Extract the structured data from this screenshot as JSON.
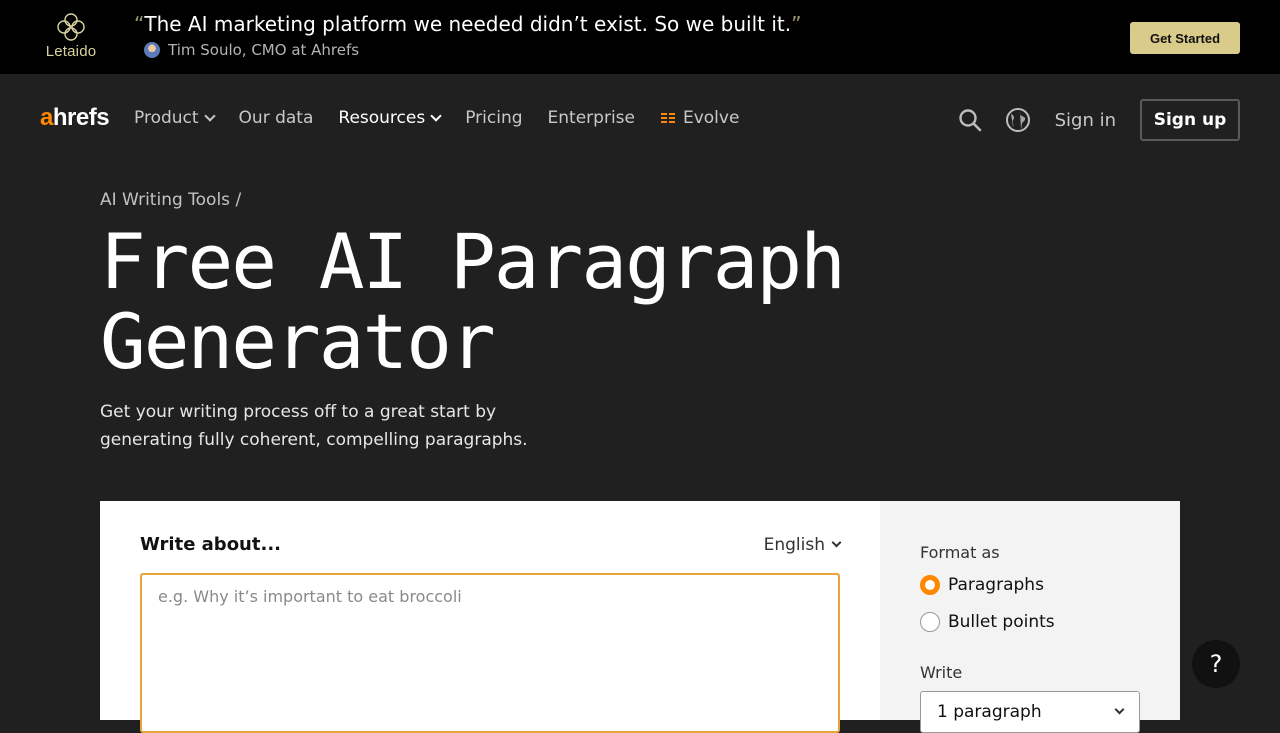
{
  "promo": {
    "logo_text": "Letaido",
    "quote_open": "“",
    "quote": "The AI marketing platform we needed didn’t exist. So we built it.",
    "quote_close": "”",
    "author": "Tim Soulo, CMO at Ahrefs",
    "cta": "Get Started"
  },
  "nav": {
    "brand_a": "a",
    "brand_rest": "hrefs",
    "items": [
      {
        "label": "Product"
      },
      {
        "label": "Our data"
      },
      {
        "label": "Resources"
      },
      {
        "label": "Pricing"
      },
      {
        "label": "Enterprise"
      },
      {
        "label": "Evolve"
      }
    ],
    "signin": "Sign in",
    "signup": "Sign up"
  },
  "hero": {
    "breadcrumb": "AI Writing Tools /",
    "title_line1": "Free AI Paragraph",
    "title_line2": "Generator",
    "subtitle": "Get your writing process off to a great start by generating fully coherent, compelling paragraphs."
  },
  "tool": {
    "write_label": "Write about...",
    "language": "English",
    "input_placeholder": "e.g. Why it’s important to eat broccoli",
    "input_value": "",
    "format_label": "Format as",
    "format_options": [
      "Paragraphs",
      "Bullet points"
    ],
    "format_selected": "Paragraphs",
    "write_count_label": "Write",
    "write_count_value": "1 paragraph"
  },
  "help": {
    "label": "?"
  },
  "colors": {
    "accent": "#ff8800",
    "promo_cta": "#d9cc8b",
    "background": "#202020",
    "input_border": "#e8a33a"
  }
}
